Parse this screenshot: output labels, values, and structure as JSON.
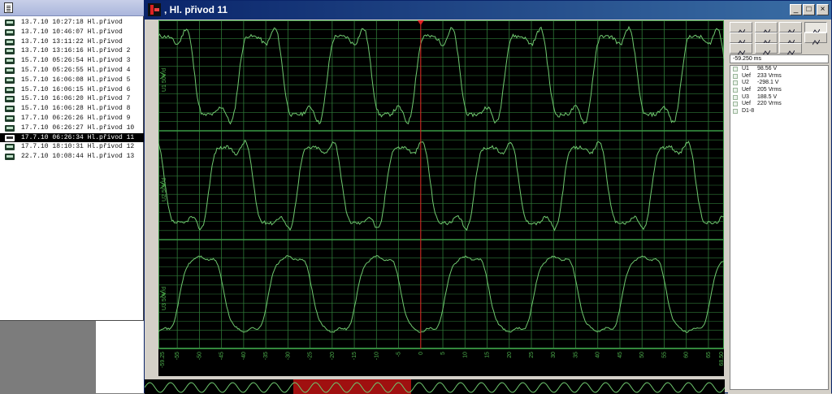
{
  "records": [
    {
      "date": "13.7.10",
      "time": "10:27:18",
      "name": "Hl.přivod",
      "selected": false
    },
    {
      "date": "13.7.10",
      "time": "10:46:07",
      "name": "Hl.přivod",
      "selected": false
    },
    {
      "date": "13.7.10",
      "time": "13:11:22",
      "name": "Hl.přivod",
      "selected": false
    },
    {
      "date": "13.7.10",
      "time": "13:16:16",
      "name": "Hl.přivod 2",
      "selected": false
    },
    {
      "date": "15.7.10",
      "time": "05:26:54",
      "name": "Hl.přivod 3",
      "selected": false
    },
    {
      "date": "15.7.10",
      "time": "05:26:55",
      "name": "Hl.přivod 4",
      "selected": false
    },
    {
      "date": "15.7.10",
      "time": "16:06:08",
      "name": "Hl.přivod 5",
      "selected": false
    },
    {
      "date": "15.7.10",
      "time": "16:06:15",
      "name": "Hl.přivod 6",
      "selected": false
    },
    {
      "date": "15.7.10",
      "time": "16:06:20",
      "name": "Hl.přivod 7",
      "selected": false
    },
    {
      "date": "15.7.10",
      "time": "16:06:28",
      "name": "Hl.přivod 8",
      "selected": false
    },
    {
      "date": "17.7.10",
      "time": "06:26:26",
      "name": "Hl.přivod 9",
      "selected": false
    },
    {
      "date": "17.7.10",
      "time": "06:26:27",
      "name": "Hl.přivod 10",
      "selected": false
    },
    {
      "date": "17.7.10",
      "time": "06:26:34",
      "name": "Hl.přivod 11",
      "selected": true
    },
    {
      "date": "17.7.10",
      "time": "18:10:31",
      "name": "Hl.přivod 12",
      "selected": false
    },
    {
      "date": "22.7.10",
      "time": "10:08:44",
      "name": "Hl.přivod 13",
      "selected": false
    }
  ],
  "window": {
    "title": ", Hl. přivod 11",
    "min_label": "_",
    "max_label": "□",
    "close_label": "×"
  },
  "toolbar": {
    "row1": [
      "wave-icon",
      "eye-icon",
      "table-icon",
      "chart-icon"
    ],
    "row2": [
      "cursor-a-icon",
      "cursor-b-icon",
      "cursor-c-icon",
      "fx-icon"
    ],
    "row3": [
      "marker-icon",
      "hourglass-icon",
      "filter-icon"
    ]
  },
  "cursor_time": "-59.250 ms",
  "legend": [
    {
      "name": "U1",
      "value": "98.56 V"
    },
    {
      "name": "Uef",
      "value": "233 Vrms"
    },
    {
      "name": "U2",
      "value": "-298.1 V"
    },
    {
      "name": "Uef",
      "value": "205 Vrms"
    },
    {
      "name": "U3",
      "value": "188.5 V"
    },
    {
      "name": "Uef",
      "value": "220 Vrms"
    },
    {
      "name": "D1-8",
      "value": ""
    }
  ],
  "scope": {
    "channel_labels": [
      "U1  50V/d",
      "U2  50V/d",
      "U3  50V/d"
    ],
    "x_ticks": [
      "-59.25",
      "-55",
      "-50",
      "-45",
      "-40",
      "-35",
      "-30",
      "-25",
      "-20",
      "-15",
      "-10",
      "-5",
      "0",
      "5",
      "10",
      "15",
      "20",
      "25",
      "30",
      "35",
      "40",
      "45",
      "50",
      "55",
      "60",
      "65",
      "68.50"
    ],
    "x_min": -59.25,
    "x_max": 68.5,
    "trace_color": "#6fc86f",
    "grid_color": "#2f7a38",
    "cursor_color": "#e02020",
    "overview_highlight_color": "#a01010"
  }
}
